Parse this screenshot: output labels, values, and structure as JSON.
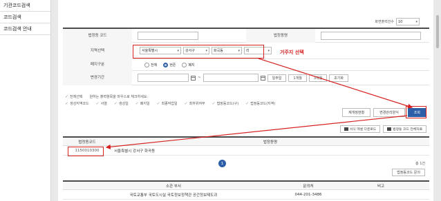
{
  "sidebar": {
    "items": [
      {
        "label": "기관코드검색"
      },
      {
        "label": "코드검색"
      },
      {
        "label": "코드검색 안내"
      }
    ]
  },
  "per_page": {
    "label": "화면출력건수",
    "value": "10"
  },
  "form": {
    "code_label": "법정동 코드",
    "name_label": "법정동명",
    "region_label": "지역선택",
    "region_values": [
      "서울특별시",
      "강서구",
      "화곡동",
      "리"
    ],
    "annotation": "거주지 선택",
    "status_label": "폐지구분",
    "status_options": [
      "전체",
      "현존",
      "폐지"
    ],
    "period_label": "변경기간",
    "period_sep": "~",
    "period_buttons": [
      "일주일",
      "1개월",
      "3개월",
      "초기화"
    ]
  },
  "checks": {
    "line1": [
      "전체선택",
      "원하는 출력항목을 마우스로 체크하세요."
    ],
    "line2": [
      "생성지역코드",
      "서열",
      "생성일",
      "폐지일",
      "최종작업일",
      "최하위여부",
      "법정동코드(구)",
      "법정동코드(지역)"
    ]
  },
  "actions": {
    "history": "제개정현황",
    "change_report": "변경관리양식",
    "search": "조회"
  },
  "exports": {
    "excel": "서식 엑셀 다운로드",
    "all_codes": "법정동 코드 전체자료"
  },
  "result": {
    "col_code": "법정동코드",
    "col_name": "법정동명",
    "rows": [
      {
        "code": "1150010300",
        "name": "서울특별시 강서구 화곡동"
      }
    ]
  },
  "pager": {
    "current": "1"
  },
  "total": "총 1건",
  "recheck_button": "법정동코드 문의",
  "org": {
    "col_dept": "소관 부서",
    "col_tel": "문의처",
    "col_note": "비고",
    "rows": [
      {
        "dept": "국토교통부 국토도시실 국토정보정책관 공간정보제도과",
        "tel": "044-201-3486",
        "note": ""
      }
    ]
  },
  "colors": {
    "accent": "#2d5fa8",
    "annotation": "#d62020"
  }
}
